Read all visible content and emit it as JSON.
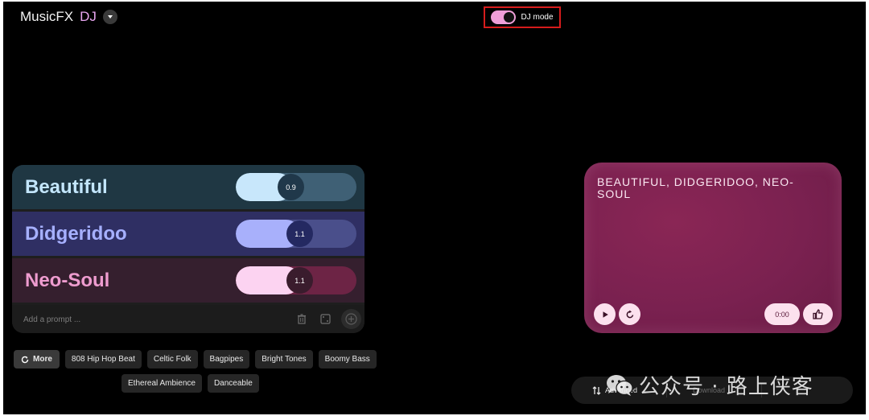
{
  "header": {
    "brand_name": "MusicFX",
    "brand_suffix": "DJ",
    "dj_mode_label": "DJ mode"
  },
  "prompts": [
    {
      "label": "Beautiful",
      "weight": "0.9",
      "color": "#c3e6fc"
    },
    {
      "label": "Didgeridoo",
      "weight": "1.1",
      "color": "#a6b0ff"
    },
    {
      "label": "Neo-Soul",
      "weight": "1.1",
      "color": "#ee9ccf"
    }
  ],
  "add_prompt": {
    "placeholder": "Add a prompt ..."
  },
  "chips": {
    "more_label": "More",
    "row1": [
      "808 Hip Hop Beat",
      "Celtic Folk",
      "Bagpipes",
      "Bright Tones",
      "Boomy Bass"
    ],
    "row2": [
      "Ethereal Ambience",
      "Danceable"
    ]
  },
  "player": {
    "title": "BEAUTIFUL, DIDGERIDOO, NEO-SOUL",
    "time": "0:00",
    "accent": "#7a2150"
  },
  "toolbar": {
    "advanced_label": "Advanced",
    "download_label": "Download"
  },
  "watermark": {
    "text": "公众号 · 路上侠客"
  }
}
